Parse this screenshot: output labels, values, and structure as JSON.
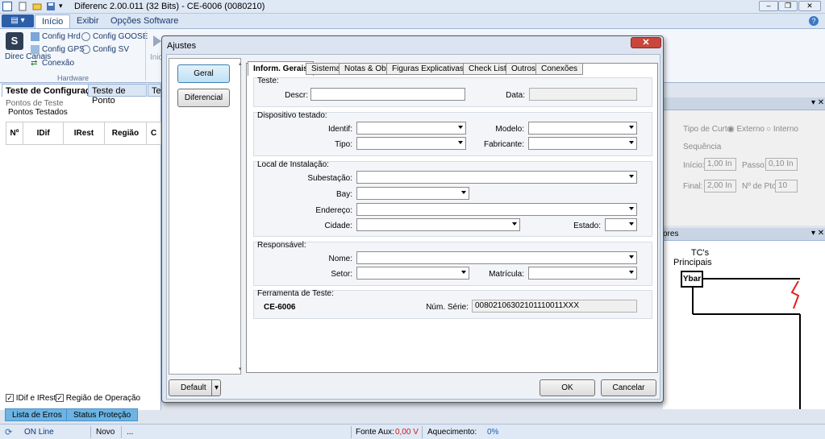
{
  "window": {
    "title": "Diferenc 2.00.011 (32 Bits) - CE-6006 (0080210)"
  },
  "ribbon": {
    "tabs": [
      "Início",
      "Exibir",
      "Opções Software"
    ],
    "items": {
      "direc_canais": "Direc Canais",
      "config_hrd": "Config Hrd",
      "config_goose": "Config GOOSE",
      "config_gps": "Config GPS",
      "config_sv": "Config SV",
      "conexao": "Conexão",
      "hardware_group": "Hardware",
      "inic": "Inic"
    }
  },
  "left": {
    "tabs": [
      "Teste de Configuração",
      "Teste de Ponto",
      "Te"
    ],
    "pontos_de_teste": "Pontos de Teste",
    "pontos_testados": "Pontos Testados",
    "columns": [
      "Nº",
      "IDif",
      "IRest",
      "Região",
      "C"
    ],
    "check1": "IDif e IRest",
    "check2": "Região de Operação",
    "bottom_tabs": [
      "Lista de Erros",
      "Status Proteção"
    ]
  },
  "right": {
    "tipo_curto": "Tipo de Curto:",
    "externo": "Externo",
    "interno": "Interno",
    "sequencia": "Sequência",
    "inicio": "Início:",
    "inicio_val": "1,00 In",
    "passo": "Passo:",
    "passo_val": "0,10 In",
    "final": "Final:",
    "final_val": "2,00 In",
    "npontos": "Nº de Ptos:",
    "npontos_val": "10",
    "ores": "ores",
    "tcs": "TC's",
    "principais": "Principais",
    "ybar": "Ybar"
  },
  "statusbar": {
    "online": "ON Line",
    "novo": "Novo",
    "dots": "...",
    "fonte_aux": "Fonte Aux:",
    "fonte_aux_val": "0,00 V",
    "aquecimento": "Aquecimento:",
    "aquecimento_val": "0%"
  },
  "dialog": {
    "title": "Ajustes",
    "side": [
      "Geral",
      "Diferencial"
    ],
    "tabs": [
      "Inform. Gerais",
      "Sistema",
      "Notas & Obs.",
      "Figuras Explicativas",
      "Check List",
      "Outros",
      "Conexões"
    ],
    "groups": {
      "teste": "Teste:",
      "dispositivo": "Dispositivo testado:",
      "local": "Local de Instalação:",
      "responsavel": "Responsável:",
      "ferramenta": "Ferramenta de Teste:"
    },
    "labels": {
      "descr": "Descr:",
      "data": "Data:",
      "identif": "Identif:",
      "modelo": "Modelo:",
      "tipo": "Tipo:",
      "fabricante": "Fabricante:",
      "subestacao": "Subestação:",
      "bay": "Bay:",
      "endereco": "Endereço:",
      "cidade": "Cidade:",
      "estado": "Estado:",
      "nome": "Nome:",
      "setor": "Setor:",
      "matricula": "Matrícula:",
      "num_serie": "Núm. Série:"
    },
    "values": {
      "device": "CE-6006",
      "num_serie": "00802106302101110011XXX"
    },
    "buttons": {
      "default": "Default",
      "ok": "OK",
      "cancel": "Cancelar"
    }
  }
}
